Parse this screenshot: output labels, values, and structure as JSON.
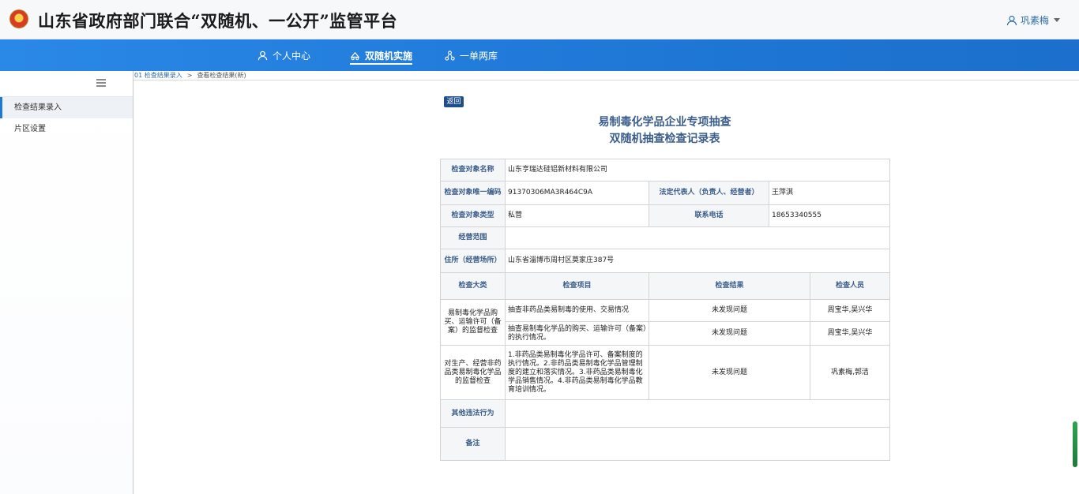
{
  "header": {
    "title": "山东省政府部门联合“双随机、一公开”监管平台",
    "user_name": "巩素梅"
  },
  "nav": {
    "items": [
      {
        "label": "个人中心",
        "icon": "person-icon"
      },
      {
        "label": "双随机实施",
        "icon": "dice-icon"
      },
      {
        "label": "一单两库",
        "icon": "network-icon"
      }
    ]
  },
  "sidebar": {
    "items": [
      {
        "label": "检查结果录入"
      },
      {
        "label": "片区设置"
      }
    ]
  },
  "breadcrumb": {
    "link": "01 检查结果录入",
    "separator": ">",
    "current": "查看检查结果(新)"
  },
  "form": {
    "back_label": "返回",
    "title_line1": "易制毒化学品企业专项抽查",
    "title_line2": "双随机抽查检查记录表",
    "rows": {
      "name_label": "检查对象名称",
      "name_value": "山东亨瑞达硅铝新材料有限公司",
      "code_label": "检查对象唯一编码",
      "code_value": "91370306MA3R464C9A",
      "legal_label": "法定代表人（负责人、经营者）",
      "legal_value": "王萍淇",
      "type_label": "检查对象类型",
      "type_value": "私营",
      "phone_label": "联系电话",
      "phone_value": "18653340555",
      "scope_label": "经营范围",
      "scope_value": "",
      "address_label": "住所（经营场所）",
      "address_value": "山东省淄博市周村区莫家庄387号"
    },
    "columns": {
      "category": "检查大类",
      "item": "检查项目",
      "result": "检查结果",
      "inspector": "检查人员"
    },
    "groups": [
      {
        "category": "易制毒化学品购买、运输许可（备案）的监督检查",
        "items": [
          {
            "item": "抽查非药品类易制毒的使用、交易情况",
            "result": "未发现问题",
            "inspector": "周宝华,吴兴华"
          },
          {
            "item": "抽查易制毒化学品的购买、运输许可（备案）的执行情况。",
            "result": "未发现问题",
            "inspector": "周宝华,吴兴华"
          }
        ]
      },
      {
        "category": "对生产、经营非药品类易制毒化学品的监督检查",
        "items": [
          {
            "item": "1.非药品类易制毒化学品许可、备案制度的执行情况。2.非药品类易制毒化学品管理制度的建立和落实情况。3.非药品类易制毒化学品销售情况。4.非药品类易制毒化学品教育培训情况。",
            "result": "未发现问题",
            "inspector": "巩素梅,郭洁"
          }
        ]
      }
    ],
    "other_label": "其他违法行为",
    "other_value": "",
    "remark_label": "备注",
    "remark_value": ""
  }
}
